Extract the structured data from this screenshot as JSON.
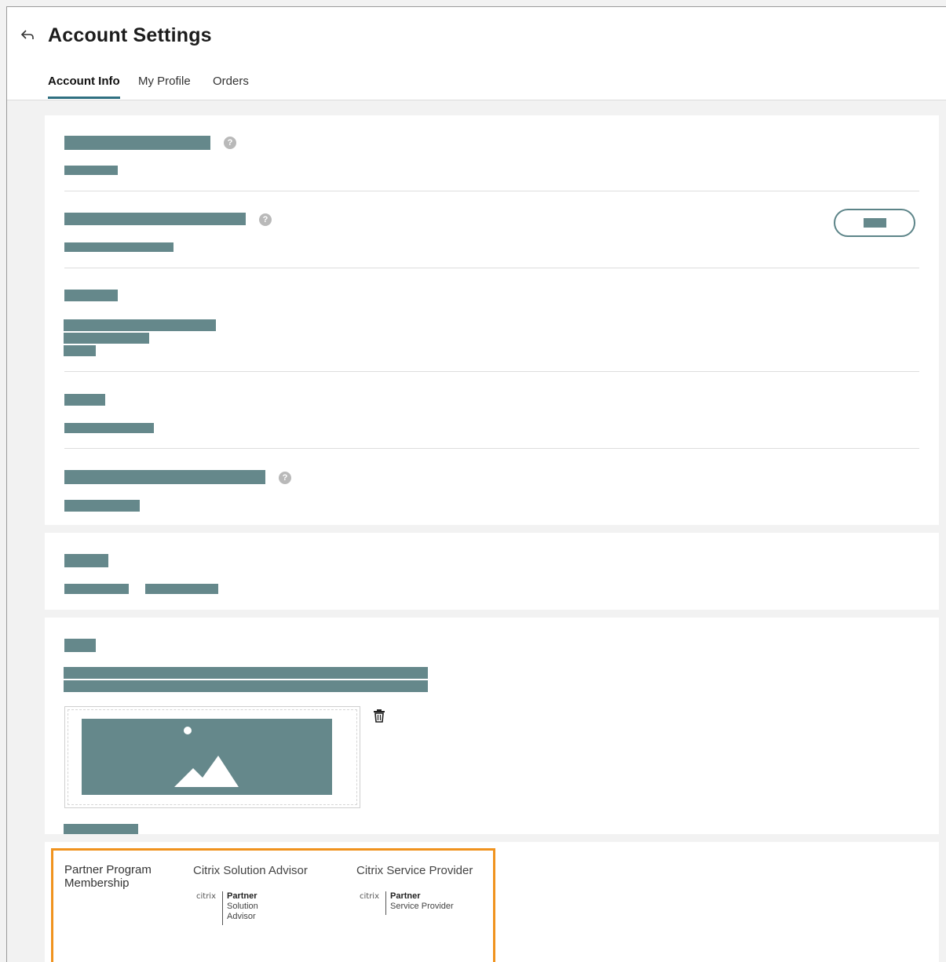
{
  "header": {
    "title": "Account Settings",
    "back_icon": "back-arrow-icon",
    "tabs": [
      {
        "label": "Account Info",
        "active": true
      },
      {
        "label": "My Profile",
        "active": false
      },
      {
        "label": "Orders",
        "active": false
      }
    ]
  },
  "icons": {
    "help": "help-icon",
    "trash": "trash-icon",
    "image": "image-placeholder-icon"
  },
  "partner_program": {
    "label": "Partner Program Membership",
    "programs": [
      {
        "title": "Citrix Solution Advisor",
        "brand": "citrix",
        "badge_title": "Partner",
        "badge_sub": "Solution Advisor"
      },
      {
        "title": "Citrix Service Provider",
        "brand": "citrix",
        "badge_title": "Partner",
        "badge_sub": "Service Provider"
      }
    ]
  },
  "colors": {
    "accent": "#2f6f80",
    "placeholder": "#65888b",
    "highlight": "#f0931e"
  }
}
